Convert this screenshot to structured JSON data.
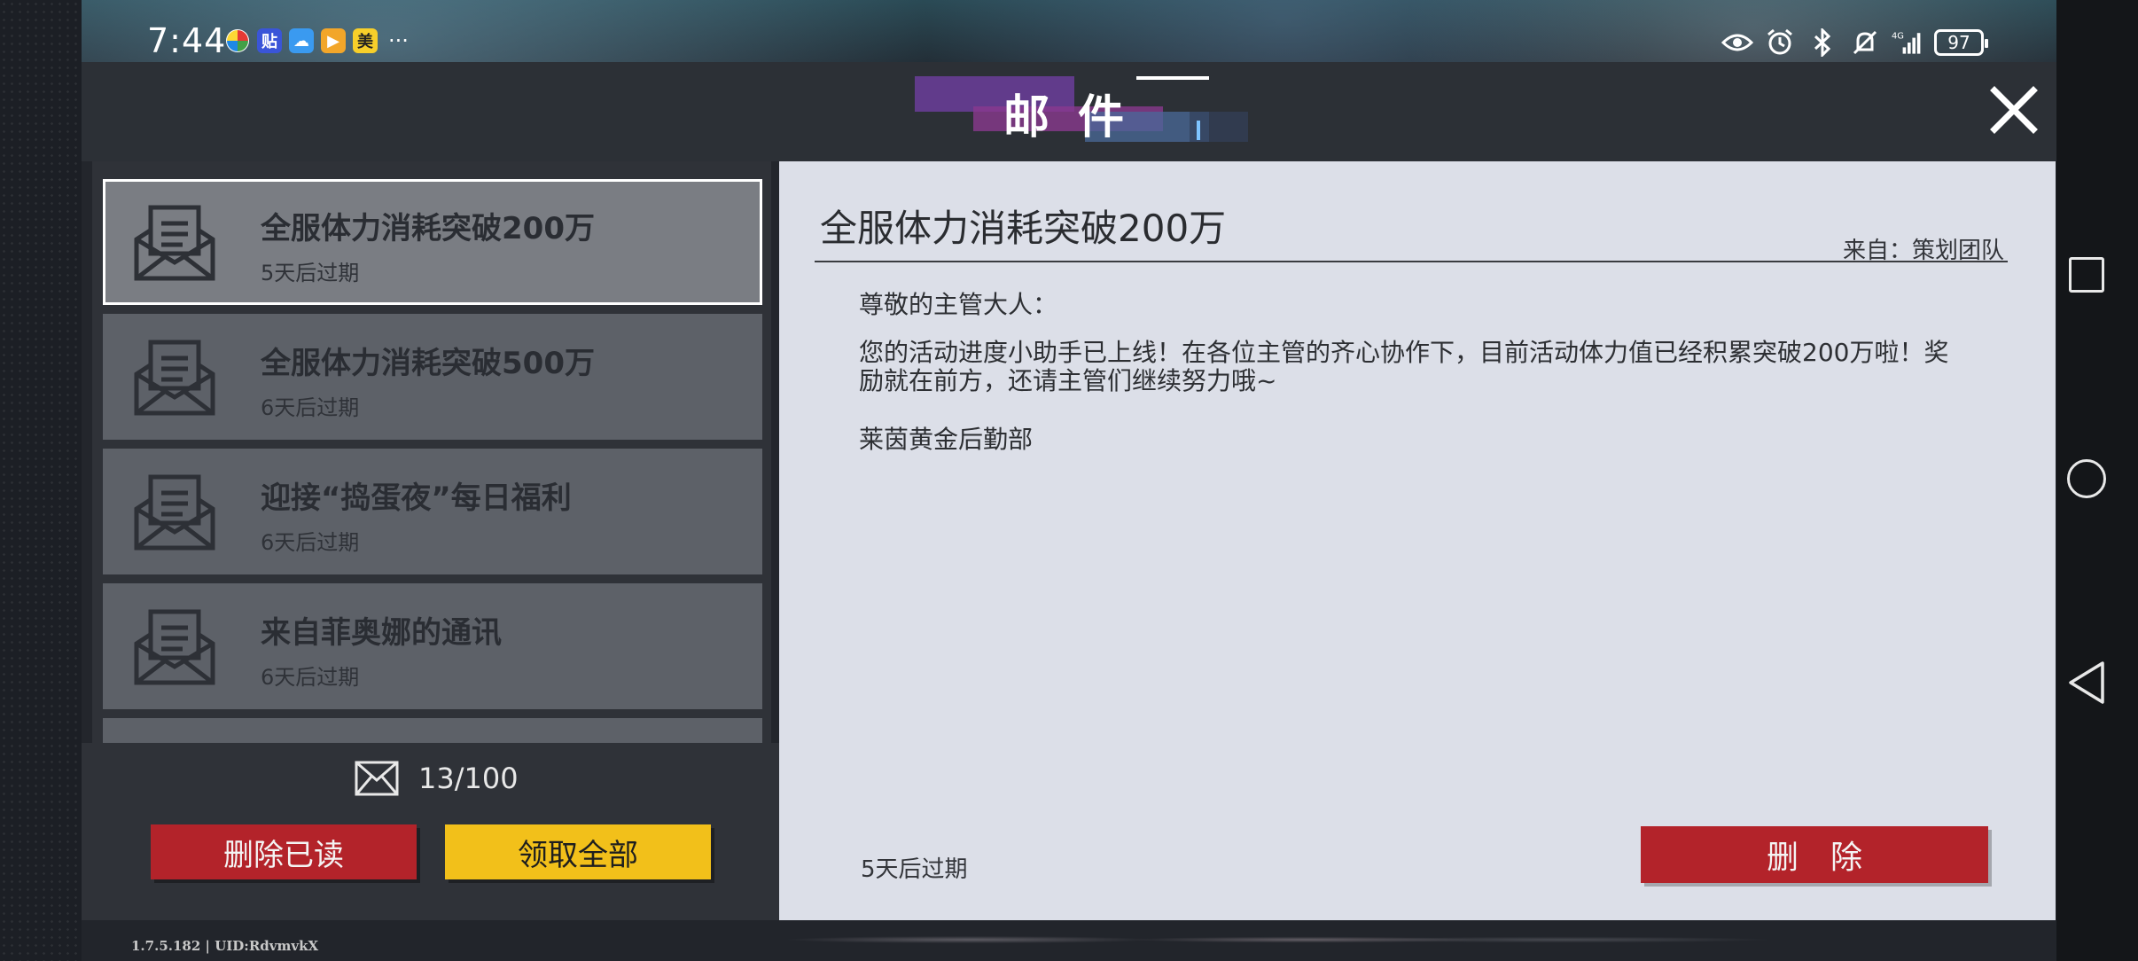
{
  "status_bar": {
    "time": "7:44",
    "apps": [
      {
        "icon": "pinwheel-app-icon",
        "glyph": "",
        "color": "#2aa3e0"
      },
      {
        "icon": "tieba-app-icon",
        "glyph": "贴",
        "color": "#3a55d8"
      },
      {
        "icon": "weather-app-icon",
        "glyph": "☁",
        "color": "#3a9af0"
      },
      {
        "icon": "video-app-icon",
        "glyph": "▶",
        "color": "#f2a62a"
      },
      {
        "icon": "meituan-app-icon",
        "glyph": "美",
        "color": "#f7cf2a"
      }
    ],
    "more": "···",
    "network": "4G",
    "battery": "97"
  },
  "window": {
    "title": "邮件",
    "close_label": "close"
  },
  "mail_list": {
    "items": [
      {
        "title": "全服体力消耗突破200万",
        "expiry": "5天后过期",
        "selected": true
      },
      {
        "title": "全服体力消耗突破500万",
        "expiry": "6天后过期",
        "selected": false
      },
      {
        "title": "迎接“捣蛋夜”每日福利",
        "expiry": "6天后过期",
        "selected": false
      },
      {
        "title": "来自菲奥娜的通讯",
        "expiry": "6天后过期",
        "selected": false
      }
    ],
    "count": "13/100",
    "delete_read_label": "删除已读",
    "claim_all_label": "领取全部"
  },
  "detail": {
    "title": "全服体力消耗突破200万",
    "from": "来自：策划团队",
    "greeting": "尊敬的主管大人：",
    "body": "您的活动进度小助手已上线！在各位主管的齐心协作下，目前活动体力值已经积累突破200万啦！奖励就在前方，还请主管们继续努力哦~",
    "signoff": "莱茵黄金后勤部",
    "expiry": "5天后过期",
    "delete_label": "删除"
  },
  "footer": {
    "version": "1.7.5.182 | UID:RdvmvkX"
  },
  "colors": {
    "danger": "#b3232a",
    "accent_yellow": "#f2c01a",
    "panel_light": "#dcdfe8"
  }
}
